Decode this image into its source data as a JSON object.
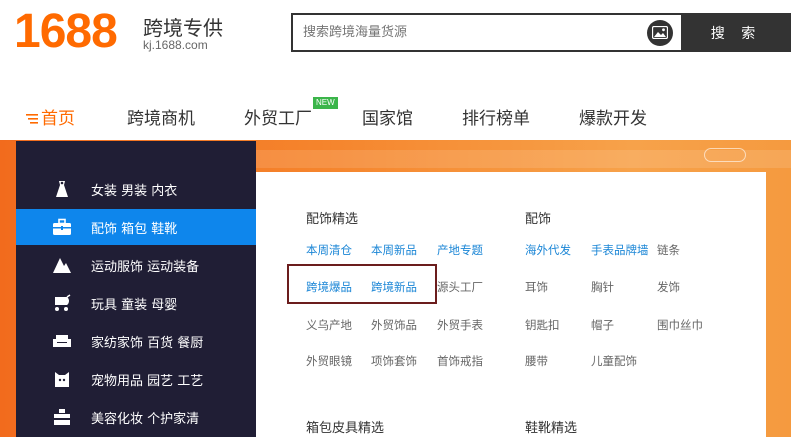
{
  "header": {
    "logo": "1688",
    "brand_cn": "跨境专供",
    "brand_url": "kj.1688.com",
    "search_placeholder": "搜索跨境海量货源",
    "search_button": "搜 索",
    "accent": "#ff6a00"
  },
  "nav": {
    "items": [
      "首页",
      "跨境商机",
      "外贸工厂",
      "国家馆",
      "排行榜单",
      "爆款开发"
    ],
    "new_badge": "NEW"
  },
  "sidebar": {
    "categories": [
      {
        "label": "女装  男装  内衣",
        "icon": "dress-icon"
      },
      {
        "label": "配饰  箱包  鞋靴",
        "icon": "briefcase-icon"
      },
      {
        "label": "运动服饰  运动装备",
        "icon": "mountain-icon"
      },
      {
        "label": "玩具  童装  母婴",
        "icon": "stroller-icon"
      },
      {
        "label": "家纺家饰  百货  餐厨",
        "icon": "sofa-icon"
      },
      {
        "label": "宠物用品  园艺  工艺",
        "icon": "pet-icon"
      },
      {
        "label": "美容化妆  个护家清",
        "icon": "cosmetics-icon"
      }
    ],
    "active_index": 1
  },
  "panel": {
    "left_title": "配饰精选",
    "left_links": [
      [
        "本周清仓",
        "本周新品",
        "产地专题"
      ],
      [
        "跨境爆品",
        "跨境新品",
        "源头工厂"
      ],
      [
        "义乌产地",
        "外贸饰品",
        "外贸手表"
      ],
      [
        "外贸眼镜",
        "项饰套饰",
        "首饰戒指"
      ]
    ],
    "right_title": "配饰",
    "right_links": [
      [
        "海外代发",
        "手表品牌墙",
        "链条"
      ],
      [
        "耳饰",
        "胸针",
        "发饰"
      ],
      [
        "钥匙扣",
        "帽子",
        "围巾丝巾"
      ],
      [
        "腰带",
        "儿童配饰"
      ]
    ],
    "bottom_left_title": "箱包皮具精选",
    "bottom_right_title": "鞋靴精选"
  }
}
